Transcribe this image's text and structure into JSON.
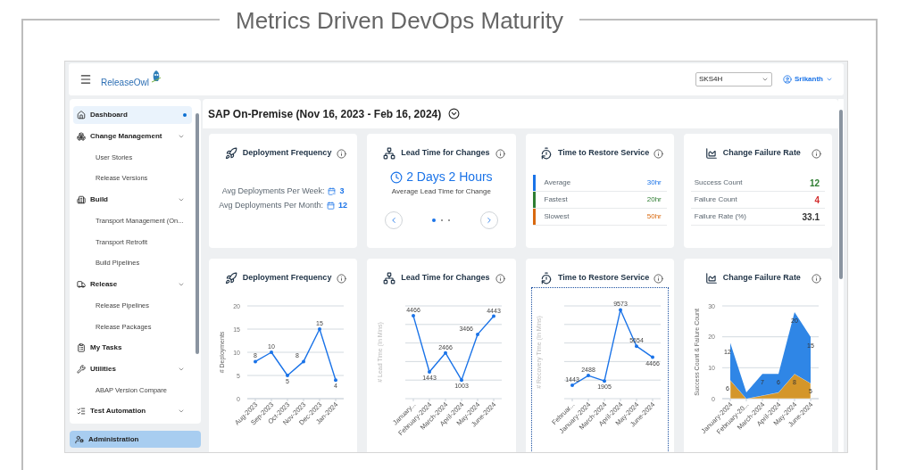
{
  "slide_title": "Metrics Driven DevOps Maturity",
  "header": {
    "logo": "ReleaseOwl",
    "system_select": {
      "value": "SKS4H"
    },
    "user": {
      "name": "Srikanth"
    }
  },
  "sidebar": {
    "items": [
      {
        "label": "Dashboard",
        "selected": true
      },
      {
        "label": "Change Management",
        "selected": false,
        "expanded": true,
        "children": [
          {
            "label": "User Stories",
            "selected": false
          },
          {
            "label": "Release Versions",
            "selected": false
          }
        ]
      },
      {
        "label": "Build",
        "selected": false,
        "expanded": true,
        "children": [
          {
            "label": "Transport Management (On...",
            "selected": false
          },
          {
            "label": "Transport Retrofit",
            "selected": false
          },
          {
            "label": "Build Pipelines",
            "selected": false
          }
        ]
      },
      {
        "label": "Release",
        "selected": false,
        "expanded": true,
        "children": [
          {
            "label": "Release Pipelines",
            "selected": false
          },
          {
            "label": "Release Packages",
            "selected": false
          }
        ]
      },
      {
        "label": "My Tasks",
        "selected": false
      },
      {
        "label": "Utilities",
        "selected": false,
        "expanded": true,
        "children": [
          {
            "label": "ABAP Version Compare",
            "selected": false
          }
        ]
      },
      {
        "label": "Test Automation",
        "selected": false,
        "expanded": true
      }
    ],
    "footer_item": {
      "label": "Administration",
      "highlighted": true
    }
  },
  "main": {
    "title": "SAP On-Premise (Nov 16, 2023 - Feb 16, 2024)",
    "summary_cards": [
      {
        "kind": "averages",
        "title": "Deployment Frequency",
        "rows": [
          {
            "label": "Avg Deployments Per Week:",
            "value": "3"
          },
          {
            "label": "Avg Deployments Per Month:",
            "value": "12"
          }
        ]
      },
      {
        "kind": "highlight",
        "title": "Lead Time for Changes",
        "value": "2 Days 2 Hours",
        "caption": "Average Lead Time for Change",
        "pages": [
          {
            "selected": true
          },
          {
            "selected": false
          },
          {
            "selected": false
          }
        ]
      },
      {
        "kind": "breakdown",
        "title": "Time to Restore Service",
        "rows": [
          {
            "label": "Average",
            "value": "30hr",
            "color": "#1a73e8"
          },
          {
            "label": "Fastest",
            "value": "20hr",
            "color": "#2e7d32"
          },
          {
            "label": "Slowest",
            "value": "50hr",
            "color": "#d9690f"
          }
        ]
      },
      {
        "kind": "counts",
        "title": "Change Failure Rate",
        "rows": [
          {
            "label": "Success Count",
            "value": "12",
            "color": "#2e7d32"
          },
          {
            "label": "Failure Count",
            "value": "4",
            "color": "#d32f2f"
          },
          {
            "label": "Failure Rate (%)",
            "value": "33.1",
            "color": "#333333"
          }
        ]
      }
    ],
    "chart_cards": [
      {
        "title": "Deployment Frequency",
        "focused": false,
        "chart_data": {
          "type": "line",
          "ylabel": "# Deployments",
          "categories": [
            "Aug-2023",
            "Sep-2023",
            "Oct-2023",
            "Nov-2023",
            "Dec-2023",
            "Jan-2024"
          ],
          "series": [
            {
              "color": "#1a73e8",
              "values": [
                8,
                10,
                5,
                8,
                15,
                4
              ]
            }
          ],
          "ylim": [
            0,
            20
          ],
          "yticks": [
            0,
            5,
            10,
            15,
            20
          ],
          "grid": true,
          "data_labels": true
        }
      },
      {
        "title": "Lead Time for Changes",
        "focused": false,
        "chart_data": {
          "type": "line",
          "ylabel": "# Lead Time (In Mins)",
          "categories": [
            "January...",
            "February-2024",
            "March-2024",
            "April-2024",
            "May-2024",
            "June-2024"
          ],
          "series": [
            {
              "color": "#1a73e8",
              "values": [
                4466,
                1443,
                2466,
                1003,
                3466,
                4443
              ]
            }
          ],
          "ylim": [
            0,
            5000
          ],
          "grid": true,
          "data_labels": true
        }
      },
      {
        "title": "Time to Restore Service",
        "focused": true,
        "chart_data": {
          "type": "line",
          "ylabel": "# Recovery Time (In Mins)",
          "categories": [
            "Februar...",
            "January-2024",
            "March-2024",
            "April-2024",
            "May-2024",
            "June-2024"
          ],
          "series": [
            {
              "color": "#1a73e8",
              "values": [
                1443,
                2488,
                1905,
                9573,
                5654,
                4466
              ]
            }
          ],
          "ylim": [
            0,
            10000
          ],
          "grid": true,
          "data_labels": true
        }
      },
      {
        "title": "Change Failure Rate",
        "focused": false,
        "chart_data": {
          "type": "area",
          "ylabel": "Success Count & Failure Count",
          "categories": [
            "January-2024",
            "February-20...",
            "March-2024",
            "April-2024",
            "May-2024",
            "June-2024"
          ],
          "series": [
            {
              "color": "#d4962a",
              "values": [
                6,
                0,
                1,
                2,
                8,
                5
              ],
              "value_labels": [
                "6",
                null,
                null,
                null,
                "8",
                "5"
              ]
            },
            {
              "color": "#2f86e6",
              "values": [
                12,
                2,
                7,
                6,
                20,
                15
              ],
              "value_labels": [
                "12",
                null,
                "7",
                "6",
                "20",
                "15"
              ]
            }
          ],
          "stacked": true,
          "ylim": [
            0,
            30
          ],
          "yticks": [
            0,
            10,
            20,
            30
          ],
          "grid": true
        }
      }
    ]
  }
}
